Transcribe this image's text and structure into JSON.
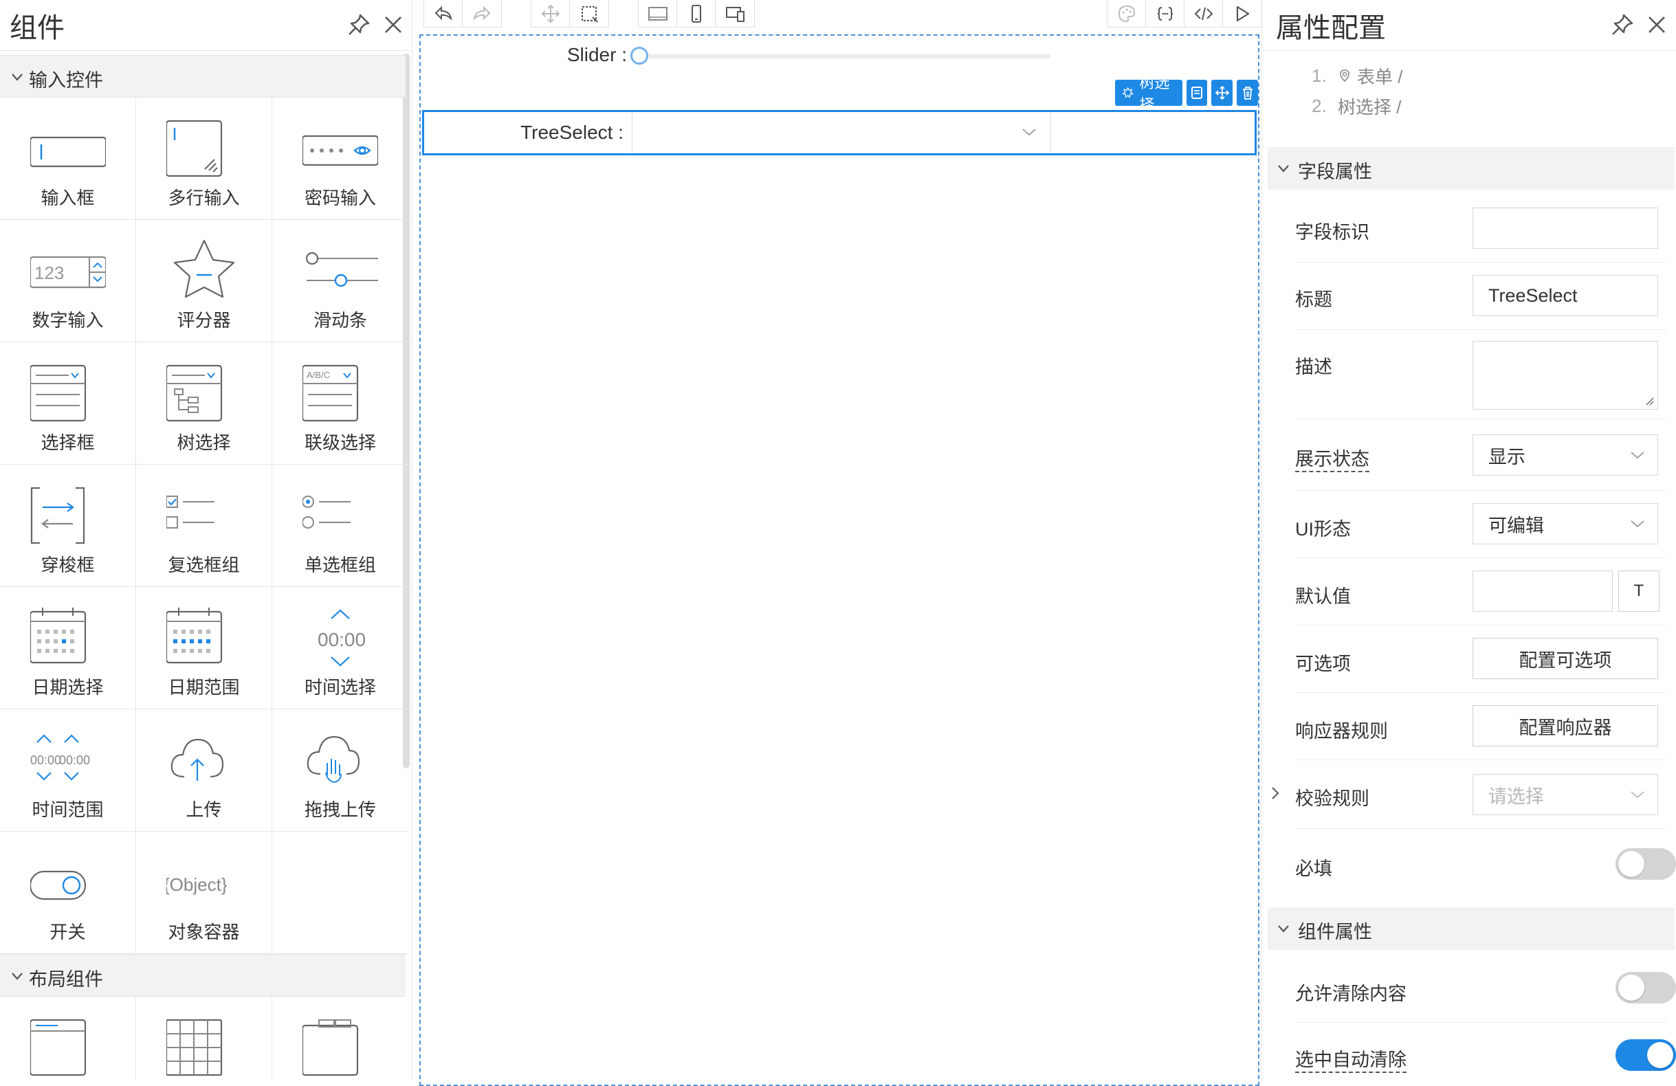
{
  "left_panel": {
    "title": "组件",
    "groups": [
      {
        "label": "输入控件",
        "items": [
          {
            "label": "输入框",
            "icon": "input-box-icon"
          },
          {
            "label": "多行输入",
            "icon": "textarea-icon"
          },
          {
            "label": "密码输入",
            "icon": "password-icon"
          },
          {
            "label": "数字输入",
            "icon": "number-input-icon",
            "icon_text": "123"
          },
          {
            "label": "评分器",
            "icon": "star-rating-icon"
          },
          {
            "label": "滑动条",
            "icon": "slider-icon"
          },
          {
            "label": "选择框",
            "icon": "select-icon"
          },
          {
            "label": "树选择",
            "icon": "tree-select-icon"
          },
          {
            "label": "联级选择",
            "icon": "cascader-icon",
            "icon_text": "A/B/C"
          },
          {
            "label": "穿梭框",
            "icon": "transfer-icon"
          },
          {
            "label": "复选框组",
            "icon": "checkbox-group-icon"
          },
          {
            "label": "单选框组",
            "icon": "radio-group-icon"
          },
          {
            "label": "日期选择",
            "icon": "date-picker-icon"
          },
          {
            "label": "日期范围",
            "icon": "date-range-icon"
          },
          {
            "label": "时间选择",
            "icon": "time-picker-icon",
            "icon_text": "00:00"
          },
          {
            "label": "时间范围",
            "icon": "time-range-icon",
            "icon_text": "00:00"
          },
          {
            "label": "上传",
            "icon": "upload-icon"
          },
          {
            "label": "拖拽上传",
            "icon": "drag-upload-icon"
          },
          {
            "label": "开关",
            "icon": "switch-icon"
          },
          {
            "label": "对象容器",
            "icon": "object-container-icon",
            "icon_text": "{Object}"
          }
        ]
      },
      {
        "label": "布局组件",
        "items": [
          {
            "label": "",
            "icon": "card-layout-icon"
          },
          {
            "label": "",
            "icon": "grid-layout-icon"
          },
          {
            "label": "",
            "icon": "tabs-layout-icon"
          }
        ]
      }
    ]
  },
  "canvas": {
    "slider_label": "Slider :",
    "treeselect_label": "TreeSelect :",
    "selected_tag": "树选择"
  },
  "right_panel": {
    "title": "属性配置",
    "breadcrumbs": [
      {
        "num": "1.",
        "text": "表单 /"
      },
      {
        "num": "2.",
        "text": "树选择 /"
      }
    ],
    "field_section": "字段属性",
    "component_section": "组件属性",
    "props": {
      "field_id": {
        "label": "字段标识",
        "value": ""
      },
      "title": {
        "label": "标题",
        "value": "TreeSelect"
      },
      "description": {
        "label": "描述",
        "value": ""
      },
      "display_state": {
        "label": "展示状态",
        "value": "显示"
      },
      "ui_mode": {
        "label": "UI形态",
        "value": "可编辑"
      },
      "default_value": {
        "label": "默认值",
        "value": "",
        "btn": "T"
      },
      "options": {
        "label": "可选项",
        "button": "配置可选项"
      },
      "responders": {
        "label": "响应器规则",
        "button": "配置响应器"
      },
      "validation": {
        "label": "校验规则",
        "placeholder": "请选择"
      },
      "required": {
        "label": "必填",
        "value": false
      },
      "allow_clear": {
        "label": "允许清除内容",
        "value": false
      },
      "auto_clear": {
        "label": "选中自动清除",
        "value": true
      }
    }
  },
  "colors": {
    "accent": "#1e88e5",
    "canvas_border": "#4a90d9",
    "panel_bg": "#f2f2f2"
  }
}
